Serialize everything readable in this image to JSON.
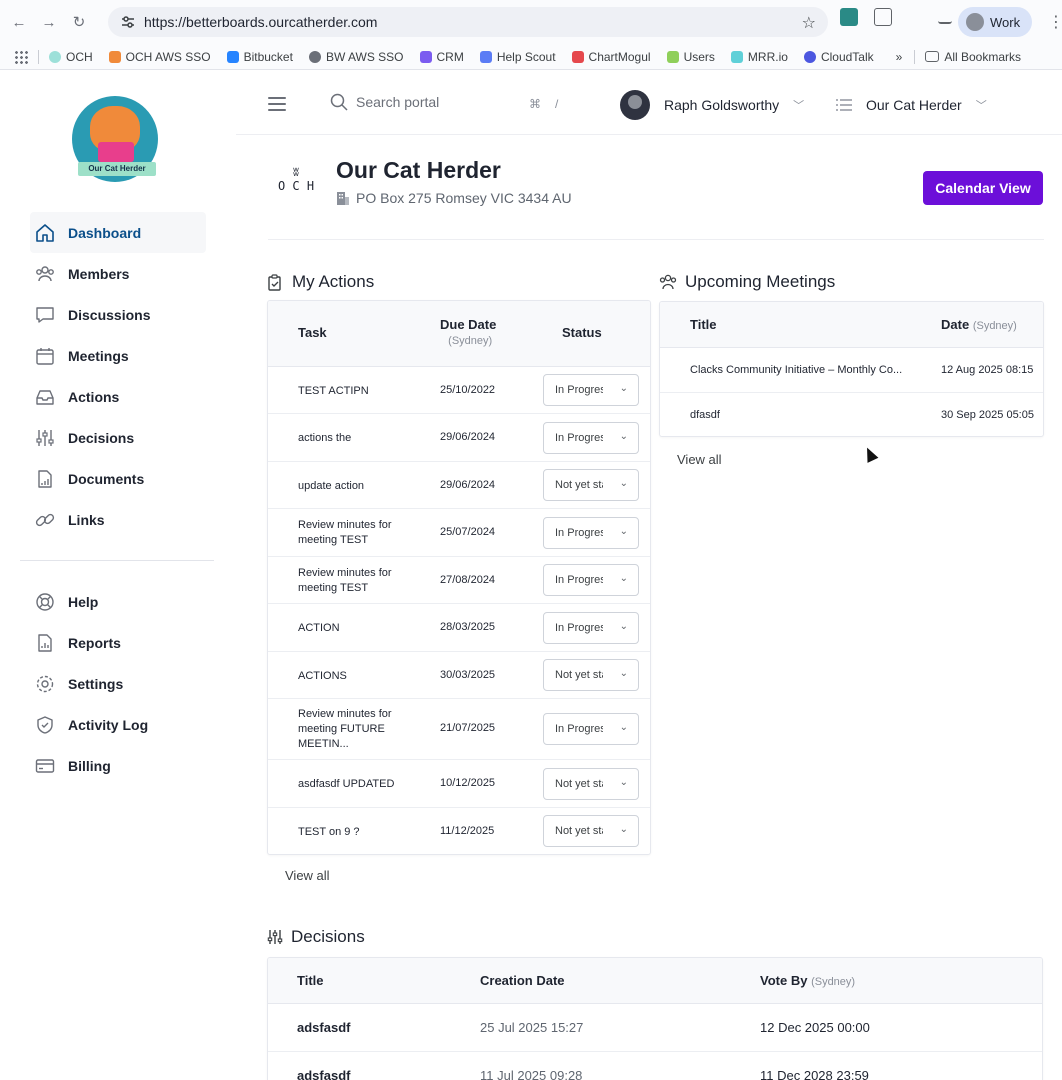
{
  "browser": {
    "url": "https://betterboards.ourcatherder.com",
    "profile_label": "Work",
    "bookmarks": [
      "OCH",
      "OCH AWS SSO",
      "Bitbucket",
      "BW AWS SSO",
      "CRM",
      "Help Scout",
      "ChartMogul",
      "Users",
      "MRR.io",
      "CloudTalk"
    ],
    "bookmark_more": "»",
    "all_bookmarks": "All Bookmarks"
  },
  "logo": {
    "banner_text": "Our Cat Herder"
  },
  "sidebar": {
    "items": [
      {
        "label": "Dashboard",
        "icon": "home-icon"
      },
      {
        "label": "Members",
        "icon": "members-icon"
      },
      {
        "label": "Discussions",
        "icon": "chat-icon"
      },
      {
        "label": "Meetings",
        "icon": "calendar-icon"
      },
      {
        "label": "Actions",
        "icon": "inbox-icon"
      },
      {
        "label": "Decisions",
        "icon": "sliders-icon"
      },
      {
        "label": "Documents",
        "icon": "document-icon"
      },
      {
        "label": "Links",
        "icon": "link-icon"
      }
    ],
    "bottom_items": [
      {
        "label": "Help",
        "icon": "lifebuoy-icon"
      },
      {
        "label": "Reports",
        "icon": "report-icon"
      },
      {
        "label": "Settings",
        "icon": "gear-icon"
      },
      {
        "label": "Activity Log",
        "icon": "shield-icon"
      },
      {
        "label": "Billing",
        "icon": "credit-card-icon"
      }
    ]
  },
  "topbar": {
    "search_placeholder": "Search portal",
    "shortcut_key1": "⌘",
    "shortcut_key2": "/",
    "user_name": "Raph Goldsworthy",
    "org_name": "Our Cat Herder"
  },
  "org": {
    "mono_line1": "ʬ",
    "mono_line2": "O C H",
    "name": "Our Cat Herder",
    "address": "PO Box 275 Romsey VIC 3434 AU",
    "calendar_button": "Calendar View"
  },
  "actions": {
    "title": "My Actions",
    "headers": {
      "task": "Task",
      "due_date": "Due Date",
      "due_tz": "(Sydney)",
      "status": "Status"
    },
    "rows": [
      {
        "task": "TEST ACTIPN",
        "due": "25/10/2022",
        "status": "In Progress"
      },
      {
        "task": "actions the",
        "due": "29/06/2024",
        "status": "In Progress"
      },
      {
        "task": "update action",
        "due": "29/06/2024",
        "status": "Not yet started"
      },
      {
        "task": "Review minutes for meeting TEST",
        "due": "25/07/2024",
        "status": "In Progress"
      },
      {
        "task": "Review minutes for meeting TEST",
        "due": "27/08/2024",
        "status": "In Progress"
      },
      {
        "task": "ACTION",
        "due": "28/03/2025",
        "status": "In Progress"
      },
      {
        "task": "ACTIONS",
        "due": "30/03/2025",
        "status": "Not yet started"
      },
      {
        "task": "Review minutes for meeting FUTURE MEETIN...",
        "due": "21/07/2025",
        "status": "In Progress"
      },
      {
        "task": "asdfasdf UPDATED",
        "due": "10/12/2025",
        "status": "Not yet started"
      },
      {
        "task": "TEST on 9 ?",
        "due": "11/12/2025",
        "status": "Not yet started"
      }
    ],
    "view_all": "View all"
  },
  "meetings": {
    "title": "Upcoming Meetings",
    "headers": {
      "title": "Title",
      "date": "Date",
      "date_tz": "(Sydney)"
    },
    "rows": [
      {
        "title": "Clacks Community Initiative – Monthly Co...",
        "date": "12 Aug 2025 08:15"
      },
      {
        "title": "dfasdf",
        "date": "30 Sep 2025 05:05"
      }
    ],
    "view_all": "View all"
  },
  "decisions": {
    "title": "Decisions",
    "headers": {
      "title": "Title",
      "created": "Creation Date",
      "vote_by": "Vote By",
      "vote_tz": "(Sydney)"
    },
    "rows": [
      {
        "title": "adsfasdf",
        "created": "25 Jul 2025 15:27",
        "vote_by": "12 Dec 2025 00:00"
      },
      {
        "title": "adsfasdf",
        "created": "11 Jul 2025 09:28",
        "vote_by": "11 Dec 2028 23:59"
      }
    ]
  },
  "colors": {
    "accent": "#6c0fd9",
    "active_nav": "#0b4f8a"
  }
}
